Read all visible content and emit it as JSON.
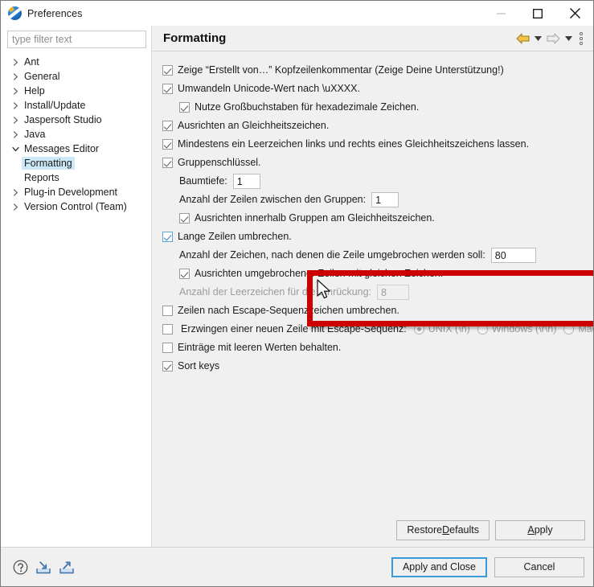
{
  "window": {
    "title": "Preferences",
    "app_icon": "eclipse-icon",
    "controls": [
      {
        "name": "minimize-button",
        "glyph": "minimize-icon",
        "enabled": false
      },
      {
        "name": "maximize-button",
        "glyph": "maximize-icon",
        "enabled": true
      },
      {
        "name": "close-button",
        "glyph": "close-icon",
        "enabled": true
      }
    ]
  },
  "sidebar": {
    "filter": {
      "value": "",
      "placeholder": "type filter text"
    },
    "items": [
      {
        "label": "Ant",
        "state": "collapsed",
        "depth": 0,
        "selected": false
      },
      {
        "label": "General",
        "state": "collapsed",
        "depth": 0,
        "selected": false
      },
      {
        "label": "Help",
        "state": "collapsed",
        "depth": 0,
        "selected": false
      },
      {
        "label": "Install/Update",
        "state": "collapsed",
        "depth": 0,
        "selected": false
      },
      {
        "label": "Jaspersoft Studio",
        "state": "collapsed",
        "depth": 0,
        "selected": false
      },
      {
        "label": "Java",
        "state": "collapsed",
        "depth": 0,
        "selected": false
      },
      {
        "label": "Messages Editor",
        "state": "expanded",
        "depth": 0,
        "selected": false
      },
      {
        "label": "Formatting",
        "state": "leaf",
        "depth": 1,
        "selected": true
      },
      {
        "label": "Reports",
        "state": "leaf",
        "depth": 1,
        "selected": false
      },
      {
        "label": "Plug-in Development",
        "state": "collapsed",
        "depth": 0,
        "selected": false
      },
      {
        "label": "Version Control (Team)",
        "state": "collapsed",
        "depth": 0,
        "selected": false
      }
    ]
  },
  "main": {
    "page_title": "Formatting",
    "nav": {
      "back_icon": "back-arrow-icon",
      "back_menu_icon": "chevron-down-icon",
      "forward_icon": "forward-arrow-icon",
      "forward_menu_icon": "chevron-down-icon",
      "view_menu_icon": "vertical-dots-icon"
    },
    "options": [
      {
        "id": "show-created-by-comment",
        "label": "Zeige “Erstellt von…” Kopfzeilenkommentar (Zeige Deine Unterstützung!)",
        "checked": true,
        "enabled": true,
        "indent": 0
      },
      {
        "id": "convert-unicode",
        "label": "Umwandeln Unicode-Wert nach \\uXXXX.",
        "checked": true,
        "enabled": true,
        "indent": 0
      },
      {
        "id": "uppercase-hex",
        "label": "Nutze Großbuchstaben für hexadezimale Zeichen.",
        "checked": true,
        "enabled": true,
        "indent": 1
      },
      {
        "id": "align-equals",
        "label": "Ausrichten an Gleichheitszeichen.",
        "checked": true,
        "enabled": true,
        "indent": 0
      },
      {
        "id": "space-around-equals",
        "label": "Mindestens ein Leerzeichen links und rechts eines Gleichheitszeichens lassen.",
        "checked": true,
        "enabled": true,
        "indent": 0
      },
      {
        "id": "group-keys",
        "label": "Gruppenschlüssel.",
        "checked": true,
        "enabled": true,
        "indent": 0
      }
    ],
    "tree_depth": {
      "label": "Baumtiefe:",
      "value": "1"
    },
    "lines_between_groups": {
      "label": "Anzahl der Zeilen zwischen den Gruppen:",
      "value": "1"
    },
    "align_within_groups": {
      "id": "align-within-groups",
      "label": "Ausrichten innerhalb Gruppen am Gleichheitszeichen.",
      "checked": true,
      "enabled": true
    },
    "highlighted": {
      "wrap_long_lines": {
        "id": "wrap-long-lines",
        "label": "Lange Zeilen umbrechen.",
        "checked": true,
        "enabled": true,
        "focused": true
      },
      "wrap_column": {
        "label": "Anzahl der Zeichen, nach denen die Zeile umgebrochen werden soll:",
        "value": "80"
      },
      "align_wrapped": {
        "id": "align-wrapped-lines",
        "label": "Ausrichten umgebrochener Zeilen mit gleichen Zeichen.",
        "checked": true,
        "enabled": true
      }
    },
    "indent_spaces": {
      "label": "Anzahl der Leerzeichen für die Einrückung:",
      "value": "8",
      "enabled": false
    },
    "wrap_after_escape": {
      "id": "wrap-after-escape",
      "label": "Zeilen nach Escape-Sequenzzeichen umbrechen.",
      "checked": false,
      "enabled": true
    },
    "force_newline": {
      "id": "force-newline-escape",
      "label": "Erzwingen einer neuen Zeile mit Escape-Sequenz:",
      "checked": false,
      "enabled": true,
      "radios": [
        {
          "label": "UNIX (\\n)",
          "selected": true,
          "enabled": false
        },
        {
          "label": "Windows (\\r\\n)",
          "selected": false,
          "enabled": false
        },
        {
          "label": "Mac (\\r)",
          "selected": false,
          "enabled": false
        }
      ]
    },
    "keep_empty": {
      "id": "keep-empty-entries",
      "label": "Einträge mit leeren Werten behalten.",
      "checked": false,
      "enabled": true
    },
    "sort_keys": {
      "id": "sort-keys",
      "label": "Sort keys",
      "checked": true,
      "enabled": true
    },
    "apply_bar": {
      "restore_defaults": {
        "pre": "Restore ",
        "accel": "D",
        "post": "efaults"
      },
      "apply": {
        "pre": "",
        "accel": "A",
        "post": "pply"
      }
    }
  },
  "footer": {
    "icons": [
      {
        "name": "help-icon"
      },
      {
        "name": "import-icon"
      },
      {
        "name": "export-icon"
      }
    ],
    "apply_and_close": "Apply and Close",
    "cancel": "Cancel"
  },
  "annotation": {
    "highlight_color": "#cc0000",
    "cursor": "mouse-pointer-icon"
  },
  "colors": {
    "accent": "#3a9ad9",
    "selection": "#cde8f6",
    "panel": "#f0f0f0",
    "highlight": "#cc0000"
  }
}
